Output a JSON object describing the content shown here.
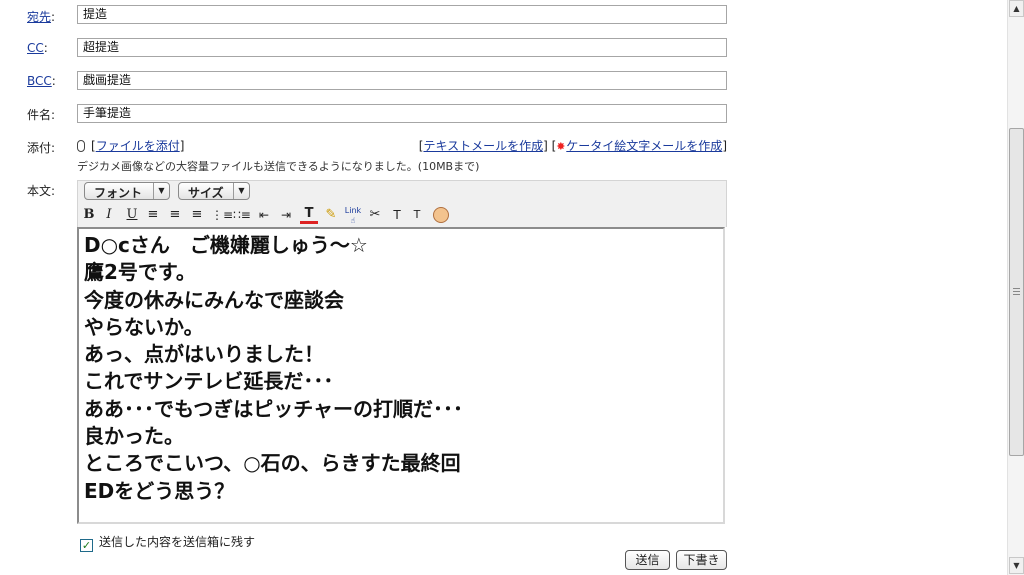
{
  "fields": {
    "to": {
      "label": "宛先",
      "suffix": ":",
      "value": "提造"
    },
    "cc": {
      "label": "CC",
      "suffix": ":",
      "value": "超提造"
    },
    "bcc": {
      "label": "BCC",
      "suffix": ":",
      "value": "戯画提造"
    },
    "subject": {
      "label": "件名:",
      "value": "手筆提造"
    }
  },
  "attach": {
    "label": "添付:",
    "add_link": "ファイルを添付",
    "text_mail_link": "テキストメールを作成",
    "keitai_link": "ケータイ絵文字メールを作成",
    "note": "デジカメ画像などの大容量ファイルも送信できるようになりました。(10MBまで)"
  },
  "body": {
    "label": "本文:",
    "toolbar": {
      "font_dropdown": "フォント",
      "size_dropdown": "サイズ",
      "link_label": "Link"
    },
    "lines": [
      "D○cさん　ご機嫌麗しゅう～☆",
      "鷹2号です。",
      "今度の休みにみんなで座談会",
      "やらないか。",
      "あっ、点がはいりました！",
      "これでサンテレビ延長だ･･･",
      "ああ･･･でもつぎはピッチャーの打順だ･･･",
      "良かった。",
      "ところでこいつ、○石の、らきすた最終回",
      "EDをどう思う？"
    ]
  },
  "save_copy": {
    "label": "送信した内容を送信箱に残す",
    "checked": true
  },
  "buttons": {
    "send": "送信",
    "draft": "下書き"
  },
  "colors": {
    "link": "#1a3a9c",
    "keitai_icon": "#e22222"
  }
}
